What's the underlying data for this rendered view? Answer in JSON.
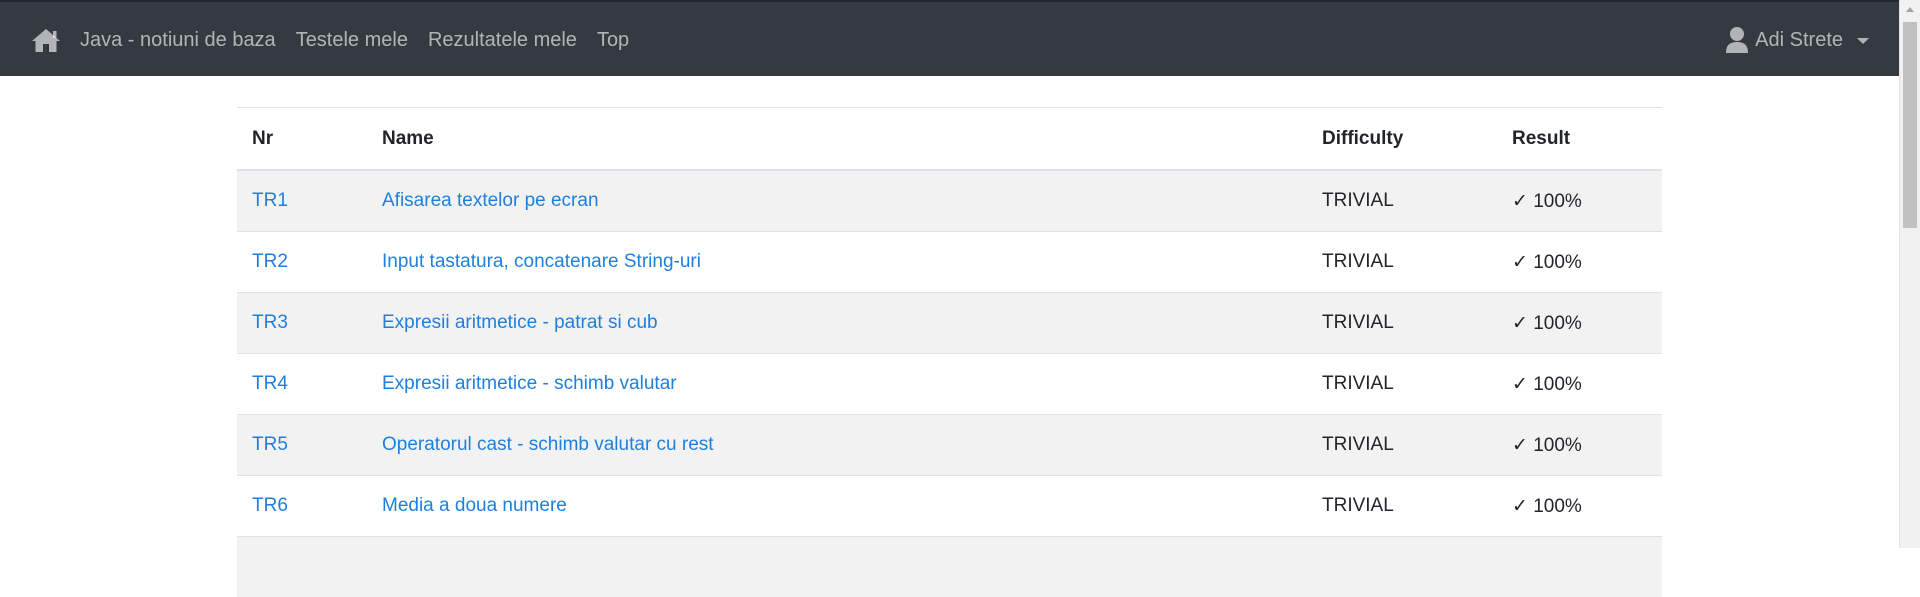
{
  "navbar": {
    "brand_icon": "home-icon",
    "links": [
      {
        "label": "Java - notiuni de baza"
      },
      {
        "label": "Testele mele"
      },
      {
        "label": "Rezultatele mele"
      },
      {
        "label": "Top"
      }
    ],
    "user": {
      "icon": "user-icon",
      "name": "Adi Strete"
    }
  },
  "table": {
    "headers": {
      "nr": "Nr",
      "name": "Name",
      "difficulty": "Difficulty",
      "result": "Result"
    },
    "rows": [
      {
        "nr": "TR1",
        "name": "Afisarea textelor pe ecran",
        "difficulty": "TRIVIAL",
        "result": "✓ 100%"
      },
      {
        "nr": "TR2",
        "name": "Input tastatura, concatenare String-uri",
        "difficulty": "TRIVIAL",
        "result": "✓ 100%"
      },
      {
        "nr": "TR3",
        "name": "Expresii aritmetice - patrat si cub",
        "difficulty": "TRIVIAL",
        "result": "✓ 100%"
      },
      {
        "nr": "TR4",
        "name": "Expresii aritmetice - schimb valutar",
        "difficulty": "TRIVIAL",
        "result": "✓ 100%"
      },
      {
        "nr": "TR5",
        "name": "Operatorul cast - schimb valutar cu rest",
        "difficulty": "TRIVIAL",
        "result": "✓ 100%"
      },
      {
        "nr": "TR6",
        "name": "Media a doua numere",
        "difficulty": "TRIVIAL",
        "result": "✓ 100%"
      }
    ]
  },
  "colors": {
    "navbar_bg": "#343a40",
    "link": "#1e7fdf",
    "stripe": "#f2f2f2"
  }
}
